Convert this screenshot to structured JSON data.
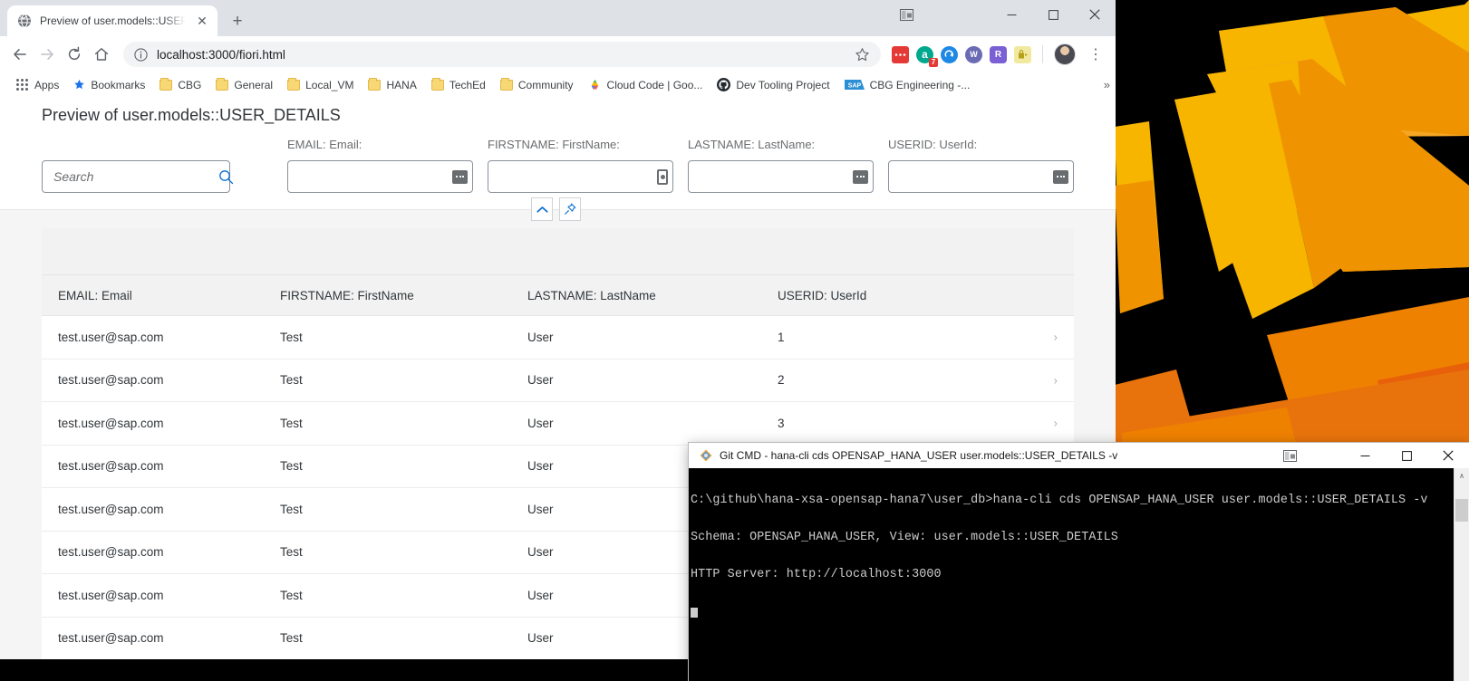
{
  "browser": {
    "tab": {
      "title": "Preview of user.models::USER_DE",
      "favicon": "globe-icon",
      "close": "✕"
    },
    "new_tab_label": "+",
    "window_controls": {
      "minimize": "—",
      "maximize": "□",
      "close": "✕",
      "snap_layouts": "panel-layout-icon"
    },
    "toolbar": {
      "back": "←",
      "forward": "→",
      "reload": "⟳",
      "home": "⌂",
      "url_protocol_icon": "info-circle-icon",
      "url": "localhost:3000/fiori.html",
      "bookmark_star": "☆",
      "menu": "⋮",
      "extensions": [
        {
          "name": "red-dots-extension",
          "glyph": "•••",
          "color": "#e53935",
          "badge": ""
        },
        {
          "name": "adblock-extension",
          "glyph": "a",
          "color": "#00a88e",
          "badge": "7"
        },
        {
          "name": "blue-arrow-extension",
          "glyph": "⟳",
          "color": "#1e88e5",
          "badge": ""
        },
        {
          "name": "w-circle-extension",
          "glyph": "W",
          "color": "#6b6bb5",
          "badge": ""
        },
        {
          "name": "r-hex-extension",
          "glyph": "R",
          "color": "#7b5fd4",
          "badge": ""
        },
        {
          "name": "lastpass-extension",
          "glyph": "⚑",
          "color": "#f0e68c",
          "badge": ""
        }
      ],
      "profile_avatar": "user-avatar"
    },
    "bookmarks": {
      "apps_label": "Apps",
      "overflow": "»",
      "items": [
        {
          "label": "Bookmarks",
          "icon": "star-icon"
        },
        {
          "label": "CBG",
          "icon": "folder-icon"
        },
        {
          "label": "General",
          "icon": "folder-icon"
        },
        {
          "label": "Local_VM",
          "icon": "folder-icon"
        },
        {
          "label": "HANA",
          "icon": "folder-icon"
        },
        {
          "label": "TechEd",
          "icon": "folder-icon"
        },
        {
          "label": "Community",
          "icon": "folder-icon"
        },
        {
          "label": "Cloud Code | Goo...",
          "icon": "google-cloud-icon"
        },
        {
          "label": "Dev Tooling Project",
          "icon": "github-icon"
        },
        {
          "label": "CBG Engineering -...",
          "icon": "sap-icon"
        }
      ]
    }
  },
  "page": {
    "title": "Preview of user.models::USER_DETAILS",
    "search": {
      "placeholder": "Search",
      "value": "",
      "icon": "magnifier-icon"
    },
    "filters": [
      {
        "label": "EMAIL: Email:",
        "value": "",
        "value_help_icon": "value-help-icon",
        "variant": "wide"
      },
      {
        "label": "FIRSTNAME: FirstName:",
        "value": "",
        "value_help_icon": "value-help-icon",
        "variant": "narrow"
      },
      {
        "label": "LASTNAME: LastName:",
        "value": "",
        "value_help_icon": "value-help-icon",
        "variant": "wide"
      },
      {
        "label": "USERID: UserId:",
        "value": "",
        "value_help_icon": "value-help-icon",
        "variant": "wide"
      }
    ],
    "filterbar_buttons": [
      {
        "name": "collapse-filterbar-button",
        "icon": "chevron-up-icon",
        "glyph": "∧"
      },
      {
        "name": "pin-filterbar-button",
        "icon": "pin-icon",
        "glyph": "⚒"
      }
    ],
    "table": {
      "columns": [
        "EMAIL: Email",
        "FIRSTNAME: FirstName",
        "LASTNAME: LastName",
        "USERID: UserId"
      ],
      "rows": [
        {
          "email": "test.user@sap.com",
          "firstname": "Test",
          "lastname": "User",
          "userid": "1"
        },
        {
          "email": "test.user@sap.com",
          "firstname": "Test",
          "lastname": "User",
          "userid": "2"
        },
        {
          "email": "test.user@sap.com",
          "firstname": "Test",
          "lastname": "User",
          "userid": "3"
        },
        {
          "email": "test.user@sap.com",
          "firstname": "Test",
          "lastname": "User",
          "userid": ""
        },
        {
          "email": "test.user@sap.com",
          "firstname": "Test",
          "lastname": "User",
          "userid": ""
        },
        {
          "email": "test.user@sap.com",
          "firstname": "Test",
          "lastname": "User",
          "userid": ""
        },
        {
          "email": "test.user@sap.com",
          "firstname": "Test",
          "lastname": "User",
          "userid": ""
        },
        {
          "email": "test.user@sap.com",
          "firstname": "Test",
          "lastname": "User",
          "userid": ""
        }
      ],
      "row_nav_glyph": "›"
    },
    "accent_color": "#0a6ed1"
  },
  "terminal": {
    "title": "Git CMD - hana-cli  cds OPENSAP_HANA_USER user.models::USER_DETAILS -v",
    "icon": "git-cmd-icon",
    "window_controls": {
      "snap": "panel-layout-icon",
      "minimize": "—",
      "maximize": "□",
      "close": "✕"
    },
    "lines": [
      "C:\\github\\hana-xsa-opensap-hana7\\user_db>hana-cli cds OPENSAP_HANA_USER user.models::USER_DETAILS -v",
      "Schema: OPENSAP_HANA_USER, View: user.models::USER_DETAILS",
      "HTTP Server: http://localhost:3000"
    ],
    "scroll_up_glyph": "∧"
  },
  "desktop": {
    "wallpaper_name": "orange-fan-shapes-on-black",
    "colors": {
      "background": "#000000",
      "light": "#f5a623",
      "mid": "#f0a000",
      "dark": "#e8730c",
      "deep": "#d95b0a",
      "yellow": "#f7b500"
    }
  }
}
